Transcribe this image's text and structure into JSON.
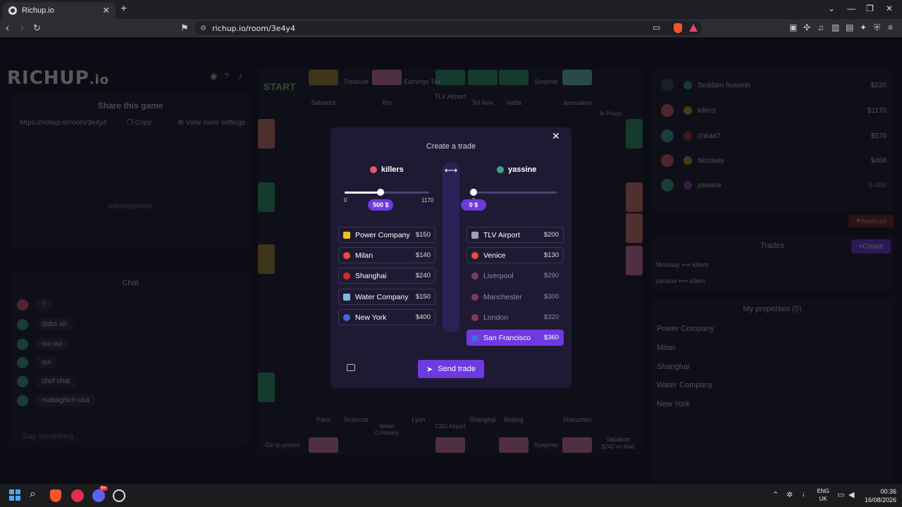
{
  "browser": {
    "tab_title": "Richup.io",
    "tab_close": "✕",
    "new_tab": "+",
    "url": "richup.io/room/3e4y4",
    "win_min": "⌄",
    "win_minimize": "—",
    "win_max": "❐",
    "win_close": "✕"
  },
  "app": {
    "logo": "RICHUP",
    "logo_suffix": ".io",
    "share_title": "Share this game",
    "share_url": "https://richup.io/room/3e4y4",
    "copy_label": "Copy",
    "settings_label": "View room settings",
    "ad_label": "advertisement",
    "chat_title": "Chat",
    "chat_placeholder": "Say something...",
    "chat_messages": [
      {
        "text": "?",
        "color": "#e05a6a"
      },
      {
        "text": "daba ah",
        "color": "#3aa67a"
      },
      {
        "text": "oui oui",
        "color": "#3aa67a"
      },
      {
        "text": "oui",
        "color": "#3aa67a"
      },
      {
        "text": "chof chat",
        "color": "#3aa67a"
      },
      {
        "text": "mabaghich usa",
        "color": "#3aa67a"
      }
    ]
  },
  "board": {
    "start": "START",
    "top": [
      "Salvador",
      "Treasure",
      "Rio",
      "Earnings Tax",
      "TLV Airport",
      "Tel Aviv",
      "Haifa",
      "Surprise",
      "Jerusalem",
      "In Prison"
    ],
    "bottom": [
      "Go to prison",
      "Paris",
      "Toulouse",
      "Water Company",
      "Lyon",
      "CDG Airport",
      "Shanghai",
      "Beijing",
      "Surprise",
      "Shenzhen",
      "Vacation"
    ],
    "vacation_sub": "$242 on hold"
  },
  "players": [
    {
      "name": "Seddam hussein",
      "money": "$220",
      "color": "#2a9d8f"
    },
    {
      "name": "killers",
      "money": "$1170",
      "color": "#e05a6a"
    },
    {
      "name": "chkaa7",
      "money": "$570",
      "color": "#3aa6a0"
    },
    {
      "name": "Nicolaay",
      "money": "$468",
      "color": "#e05a6a"
    },
    {
      "name": "yassine",
      "money": "$-488",
      "color": "#3aa67a"
    }
  ],
  "bankrupt_label": "Bankrupt",
  "trades": {
    "title": "Trades",
    "create_label": "Create",
    "rows": [
      {
        "a": "Nicolaay",
        "arrow": "⟷",
        "b": "killers"
      },
      {
        "a": "yassine",
        "arrow": "⟷",
        "b": "killers"
      }
    ]
  },
  "my_properties": {
    "title": "My properties (5)",
    "items": [
      "Power Company",
      "Milan",
      "Shanghai",
      "Water Company",
      "New York"
    ]
  },
  "trade_modal": {
    "title": "Create a trade",
    "close": "✕",
    "swap": "⟷",
    "left": {
      "name": "killers",
      "color": "#e05a6a",
      "min": "0",
      "max": "1170",
      "amount_label": "500 $",
      "slider_fraction": 0.427,
      "properties": [
        {
          "name": "Power Company",
          "price": "$150",
          "icon": "#f1c40f",
          "state": "normal"
        },
        {
          "name": "Milan",
          "price": "$140",
          "icon": "#e74c3c",
          "state": "normal"
        },
        {
          "name": "Shanghai",
          "price": "$240",
          "icon": "#d62828",
          "state": "normal"
        },
        {
          "name": "Water Company",
          "price": "$150",
          "icon": "#7fb8d8",
          "state": "normal"
        },
        {
          "name": "New York",
          "price": "$400",
          "icon": "#3c6ed8",
          "state": "normal"
        }
      ]
    },
    "right": {
      "name": "yassine",
      "color": "#3aa67a",
      "min": "0",
      "amount_label": "0 $",
      "slider_fraction": 0,
      "properties": [
        {
          "name": "TLV Airport",
          "price": "$200",
          "icon": "#9aa6b4",
          "state": "normal"
        },
        {
          "name": "Venice",
          "price": "$130",
          "icon": "#e74c3c",
          "state": "normal"
        },
        {
          "name": "Liverpool",
          "price": "$290",
          "icon": "#c0526a",
          "state": "off"
        },
        {
          "name": "Manchester",
          "price": "$300",
          "icon": "#c0526a",
          "state": "off"
        },
        {
          "name": "London",
          "price": "$320",
          "icon": "#c0526a",
          "state": "off"
        },
        {
          "name": "San Francisco",
          "price": "$360",
          "icon": "#3c6ed8",
          "state": "selected"
        }
      ]
    },
    "send_label": "Send trade"
  },
  "taskbar": {
    "lang_top": "ENG",
    "lang_bottom": "UK",
    "time": "00:36",
    "date": "16/08/2026",
    "discord_badge": "9+"
  },
  "colors": {
    "accent": "#6d3ae0",
    "modal_bg": "#1f1a33"
  }
}
